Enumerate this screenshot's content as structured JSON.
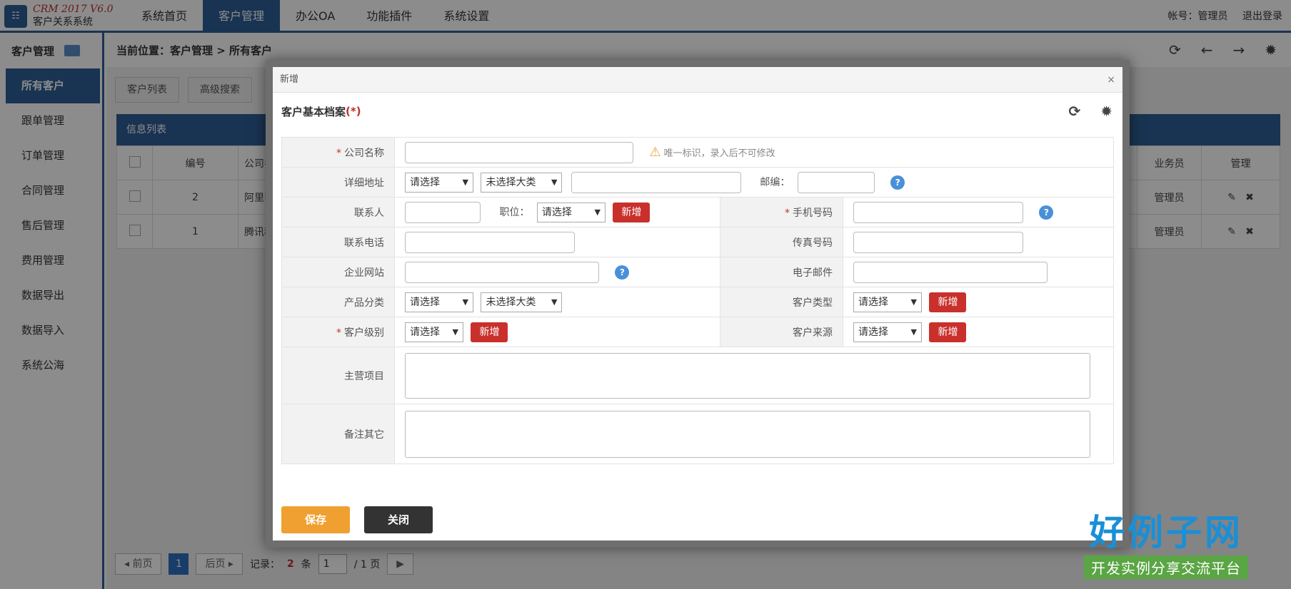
{
  "app": {
    "version": "CRM 2017 V6.0",
    "name": "客户关系系统",
    "logo_glyph": "☷"
  },
  "nav": {
    "items": [
      {
        "label": "系统首页",
        "active": false
      },
      {
        "label": "客户管理",
        "active": true
      },
      {
        "label": "办公OA",
        "active": false
      },
      {
        "label": "功能插件",
        "active": false
      },
      {
        "label": "系统设置",
        "active": false
      }
    ]
  },
  "account": {
    "label": "帐号：管理员",
    "logout": "退出登录"
  },
  "sidebar": {
    "title": "客户管理",
    "items": [
      {
        "label": "所有客户",
        "active": true
      },
      {
        "label": "跟单管理"
      },
      {
        "label": "订单管理"
      },
      {
        "label": "合同管理"
      },
      {
        "label": "售后管理"
      },
      {
        "label": "费用管理"
      },
      {
        "label": "数据导出"
      },
      {
        "label": "数据导入"
      },
      {
        "label": "系统公海"
      }
    ]
  },
  "breadcrumb": {
    "text": "当前位置：客户管理 > 所有客户"
  },
  "toolbar": {
    "list": "客户列表",
    "search": "高级搜索"
  },
  "list": {
    "title": "信息列表",
    "headers": [
      "编号",
      "公司名",
      "业务员",
      "管理"
    ],
    "rows": [
      {
        "id": "2",
        "company": "阿里巴",
        "owner": "管理员"
      },
      {
        "id": "1",
        "company": "腾讯科",
        "owner": "管理员"
      }
    ]
  },
  "pager": {
    "prev": "◂ 前页",
    "page": "1",
    "next": "后页 ▸",
    "records_label": "记录：",
    "records": "2",
    "records_unit": "条",
    "current": "1",
    "total": "/ 1 页",
    "go": "▶"
  },
  "modal": {
    "title": "新增",
    "heading": "客户基本档案",
    "heading_req": "(*)",
    "fields": {
      "company": "公司名称",
      "company_hint": "唯一标识，录入后不可修改",
      "address": "详细地址",
      "address_sel1": "请选择",
      "address_sel2": "未选择大类",
      "zipcode": "邮编：",
      "contact": "联系人",
      "position": "职位：",
      "position_sel": "请选择",
      "add": "新增",
      "mobile": "手机号码",
      "phone": "联系电话",
      "fax": "传真号码",
      "website": "企业网站",
      "email": "电子邮件",
      "category": "产品分类",
      "category_sel1": "请选择",
      "category_sel2": "未选择大类",
      "cust_type": "客户类型",
      "cust_type_sel": "请选择",
      "level": "客户级别",
      "level_sel": "请选择",
      "source": "客户来源",
      "source_sel": "请选择",
      "business": "主营项目",
      "remark": "备注其它"
    },
    "save": "保存",
    "close": "关闭"
  },
  "watermark": {
    "title": "好例子网",
    "subtitle": "开发实例分享交流平台"
  }
}
